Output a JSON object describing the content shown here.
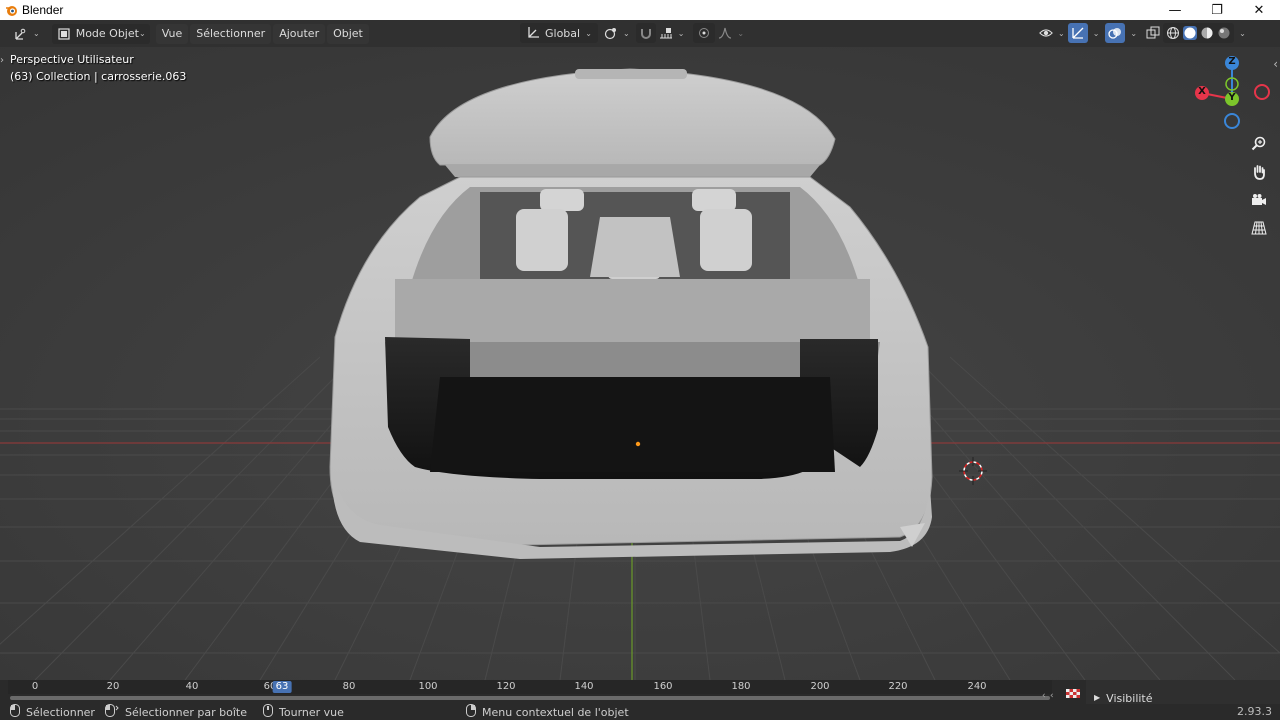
{
  "window": {
    "title": "Blender",
    "minimize": "—",
    "restore": "❐",
    "close": "✕"
  },
  "header": {
    "mode_label": "Mode Objet",
    "menus": [
      "Vue",
      "Sélectionner",
      "Ajouter",
      "Objet"
    ],
    "orientation_label": "Global"
  },
  "viewport": {
    "view_name": "Perspective Utilisateur",
    "collection_info": "(63) Collection | carrosserie.063",
    "gizmo": {
      "z_label": "Z",
      "y_label": "Y",
      "x_label": "X",
      "x_color": "#e6354a",
      "y_color": "#7cc52b",
      "z_color": "#3a86d8"
    }
  },
  "timeline": {
    "current_frame": "63",
    "frame_labels": [
      "0",
      "20",
      "40",
      "60",
      "80",
      "100",
      "120",
      "140",
      "160",
      "180",
      "200",
      "220",
      "240"
    ],
    "visibility_label": "Visibilité"
  },
  "statusbar": {
    "select": "Sélectionner",
    "box_select": "Sélectionner par boîte",
    "rotate_view": "Tourner vue",
    "context_menu": "Menu contextuel de l'objet",
    "version": "2.93.3"
  },
  "colors": {
    "accent_blue": "#4772b3",
    "viewport_bg": "#3d3d3d",
    "header_bg": "#303030"
  }
}
